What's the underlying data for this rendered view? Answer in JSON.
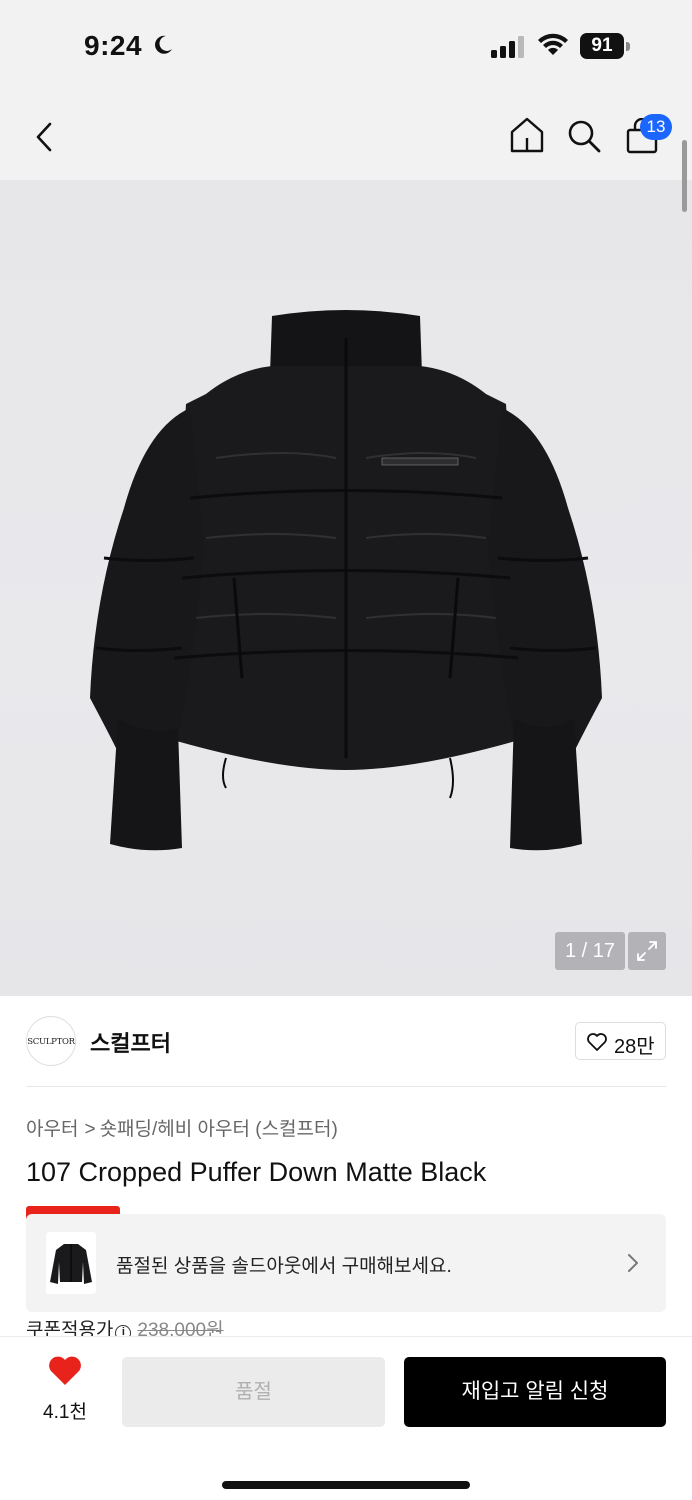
{
  "status_bar": {
    "time": "9:24",
    "battery": "91",
    "icons": [
      "moon-icon",
      "cellular-signal-icon",
      "wifi-icon",
      "battery-icon"
    ]
  },
  "nav": {
    "icons": [
      "back-chevron-icon",
      "home-icon",
      "search-icon",
      "shopping-bag-icon"
    ],
    "cart_count": "13"
  },
  "gallery": {
    "counter": "1 / 17",
    "current_index": 1,
    "total": 17
  },
  "brand": {
    "logo_text": "SCULPTOR",
    "name": "스컬프터",
    "like_count": "28만"
  },
  "product": {
    "breadcrumb": [
      "아우터",
      "숏패딩/헤비 아우터 (스컬프터)"
    ],
    "breadcrumb_separator": ">",
    "title": "107 Cropped Puffer Down Matte Black"
  },
  "soldout_notice": {
    "message": "품절된 상품을 솔드아웃에서 구매해보세요."
  },
  "price": {
    "label": "쿠폰적용가",
    "info_glyph": "i",
    "original": "238,000원"
  },
  "bottom_bar": {
    "wish_count": "4.1천",
    "soldout_button": "품절",
    "restock_button": "재입고 알림 신청"
  },
  "colors": {
    "accent_blue": "#1a66ff",
    "heart_red": "#e8231b",
    "primary_button": "#000000"
  }
}
